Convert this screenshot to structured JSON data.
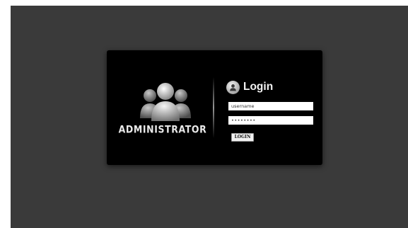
{
  "brand": {
    "label": "ADMINISTRATOR",
    "logo_icon": "user-group-icon"
  },
  "login": {
    "title": "Login",
    "title_icon": "user-icon",
    "username": {
      "value": "username"
    },
    "password": {
      "value": "••••••••"
    },
    "button_label": "LOGIN"
  },
  "colors": {
    "background": "#3a3a3a",
    "card": "#000000",
    "text": "#f2f2f2"
  }
}
